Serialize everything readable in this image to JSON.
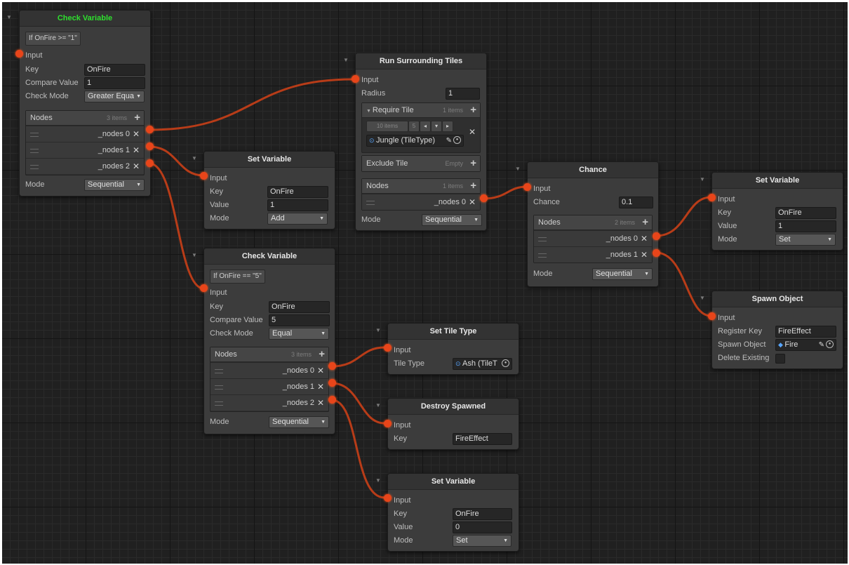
{
  "nodes": {
    "check1": {
      "title": "Check Variable",
      "condition": "If OnFire >= \"1\"",
      "input": "Input",
      "key_label": "Key",
      "key_value": "OnFire",
      "compare_label": "Compare Value",
      "compare_value": "1",
      "mode_label": "Check Mode",
      "mode_value": "Greater Equa",
      "list_label": "Nodes",
      "list_count": "3 items",
      "items": [
        "_nodes 0",
        "_nodes 1",
        "_nodes 2"
      ],
      "exec_label": "Mode",
      "exec_value": "Sequential"
    },
    "run": {
      "title": "Run Surrounding Tiles",
      "input": "Input",
      "radius_label": "Radius",
      "radius_value": "1",
      "require_label": "Require Tile",
      "require_count": "1 items",
      "sub_count": "10 items",
      "sub_size": "5",
      "tile_value": "Jungle (TileType)",
      "exclude_label": "Exclude Tile",
      "exclude_value": "Empty",
      "list_label": "Nodes",
      "list_count": "1 items",
      "items": [
        "_nodes 0"
      ],
      "exec_label": "Mode",
      "exec_value": "Sequential"
    },
    "set1": {
      "title": "Set Variable",
      "input": "Input",
      "key_label": "Key",
      "key_value": "OnFire",
      "value_label": "Value",
      "value_value": "1",
      "mode_label": "Mode",
      "mode_value": "Add"
    },
    "check2": {
      "title": "Check Variable",
      "condition": "If OnFire == \"5\"",
      "input": "Input",
      "key_label": "Key",
      "key_value": "OnFire",
      "compare_label": "Compare Value",
      "compare_value": "5",
      "mode_label": "Check Mode",
      "mode_value": "Equal",
      "list_label": "Nodes",
      "list_count": "3 items",
      "items": [
        "_nodes 0",
        "_nodes 1",
        "_nodes 2"
      ],
      "exec_label": "Mode",
      "exec_value": "Sequential"
    },
    "chance": {
      "title": "Chance",
      "input": "Input",
      "chance_label": "Chance",
      "chance_value": "0.1",
      "list_label": "Nodes",
      "list_count": "2 items",
      "items": [
        "_nodes 0",
        "_nodes 1"
      ],
      "exec_label": "Mode",
      "exec_value": "Sequential"
    },
    "set2": {
      "title": "Set Variable",
      "input": "Input",
      "key_label": "Key",
      "key_value": "OnFire",
      "value_label": "Value",
      "value_value": "1",
      "mode_label": "Mode",
      "mode_value": "Set"
    },
    "spawn": {
      "title": "Spawn Object",
      "input": "Input",
      "regkey_label": "Register Key",
      "regkey_value": "FireEffect",
      "obj_label": "Spawn Object",
      "obj_value": "Fire",
      "delete_label": "Delete Existing"
    },
    "settile": {
      "title": "Set Tile Type",
      "input": "Input",
      "type_label": "Tile Type",
      "type_value": "Ash (TileT"
    },
    "destroy": {
      "title": "Destroy Spawned",
      "input": "Input",
      "key_label": "Key",
      "key_value": "FireEffect"
    },
    "set3": {
      "title": "Set Variable",
      "input": "Input",
      "key_label": "Key",
      "key_value": "OnFire",
      "value_label": "Value",
      "value_value": "0",
      "mode_label": "Mode",
      "mode_value": "Set"
    }
  },
  "colors": {
    "wire": "#c0401a",
    "port": "#e8451a",
    "title_highlight": "#2ee02e"
  },
  "icons": [
    "collapse-triangle-icon",
    "plus-icon",
    "remove-x-icon",
    "drag-handle-icon",
    "pencil-icon",
    "object-picker-icon",
    "dropdown-arrow-icon",
    "prefab-icon"
  ]
}
